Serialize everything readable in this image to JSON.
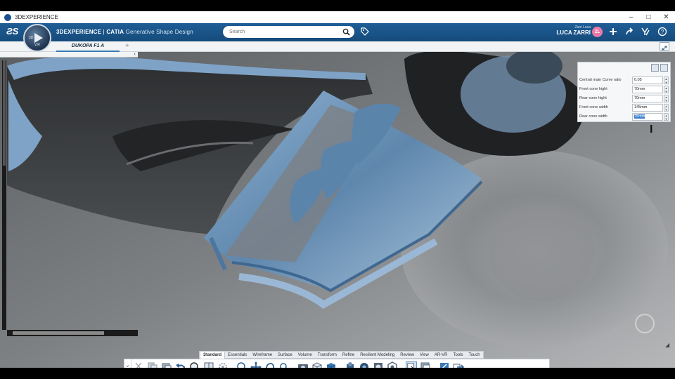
{
  "window": {
    "title": "3DEXPERIENCE",
    "controls": [
      "–",
      "□",
      "✕"
    ]
  },
  "header": {
    "brand_prefix": "3DEXPERIENCE",
    "brand_separator": " | ",
    "brand_product": "CATIA",
    "brand_app": "Generative Shape Design",
    "compass_label": "3D",
    "compass_version": "V.R",
    "search_placeholder": "Search",
    "user_small": "Zarri Luca",
    "user_name": "LUCA ZARRI",
    "avatar_initials": "ZL",
    "icons": [
      "tag-icon",
      "plus-icon",
      "share-icon",
      "collaboration-icon",
      "help-icon"
    ],
    "accent_color": "#164b7c"
  },
  "tabs": {
    "active": "DUKOPA F1 A",
    "add_label": "+"
  },
  "param_panel": {
    "rows": [
      {
        "label": "Central main Curve ratio",
        "value": "0.05"
      },
      {
        "label": "Front cone hight",
        "value": "70mm"
      },
      {
        "label": "Rear cone hight",
        "value": "70mm"
      },
      {
        "label": "Front cone width",
        "value": "145mm"
      },
      {
        "label": "Rear cone width",
        "value": "75mm",
        "selected": true
      }
    ]
  },
  "action_tabs": [
    "Standard",
    "Essentials",
    "Wireframe",
    "Surface",
    "Volume",
    "Transform",
    "Refine",
    "Resilient Modeling",
    "Review",
    "View",
    "AR-VR",
    "Tools",
    "Touch"
  ],
  "active_action_tab": "Standard",
  "toolbar": {
    "tools": [
      "cut-icon",
      "copy-icon",
      "paste-icon",
      "undo-icon",
      "zoom-fit-icon",
      "book-icon",
      "settings-icon",
      "zoom-in-icon",
      "pan-icon",
      "rotate-icon",
      "zoom-area-icon",
      "capture-icon",
      "view-cube-icon",
      "shading-icon",
      "render-icon",
      "material-icon",
      "ambient-icon",
      "display-icon",
      "selection-icon",
      "layers-icon",
      "sketch-icon",
      "export-icon"
    ]
  }
}
